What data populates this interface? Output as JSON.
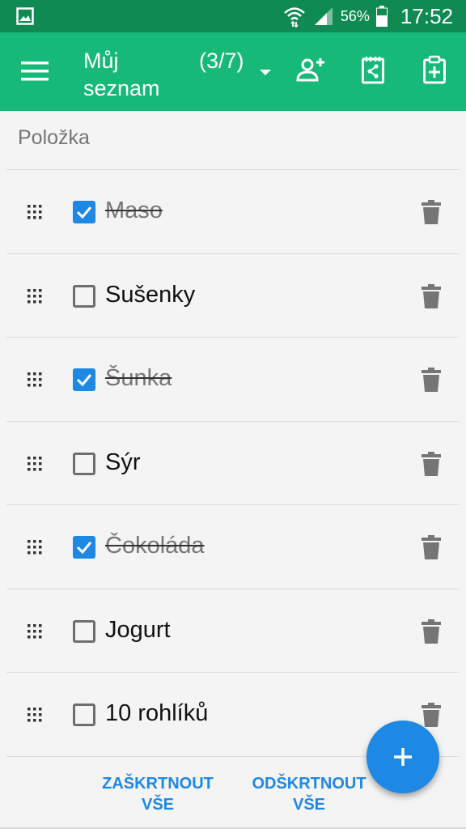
{
  "status_bar": {
    "battery_percent": "56%",
    "time": "17:52",
    "colors": {
      "background": "#0f8a52"
    }
  },
  "app_bar": {
    "title": "Můj seznam",
    "count": "(3/7)",
    "menu_icon": "menu-icon",
    "dropdown_icon": "dropdown-arrow-icon",
    "actions": [
      {
        "icon": "add-person-icon"
      },
      {
        "icon": "share-list-icon"
      },
      {
        "icon": "add-clipboard-icon"
      }
    ],
    "colors": {
      "background": "#17b978"
    }
  },
  "list_header": "Položka",
  "items": [
    {
      "text": "Maso",
      "checked": true
    },
    {
      "text": "Sušenky",
      "checked": false
    },
    {
      "text": "Šunka",
      "checked": true
    },
    {
      "text": "Sýr",
      "checked": false
    },
    {
      "text": "Čokoláda",
      "checked": true
    },
    {
      "text": "Jogurt",
      "checked": false
    },
    {
      "text": "10 rohlíků",
      "checked": false
    }
  ],
  "buttons": {
    "check_all_line1": "ZAŠKRTNOUT",
    "check_all_line2": "VŠE",
    "uncheck_all_line1": "ODŠKRTNOUT",
    "uncheck_all_line2": "VŠE"
  },
  "fab": {
    "icon": "plus-icon"
  },
  "colors": {
    "accent": "#1e88e5",
    "trash": "#757575"
  }
}
